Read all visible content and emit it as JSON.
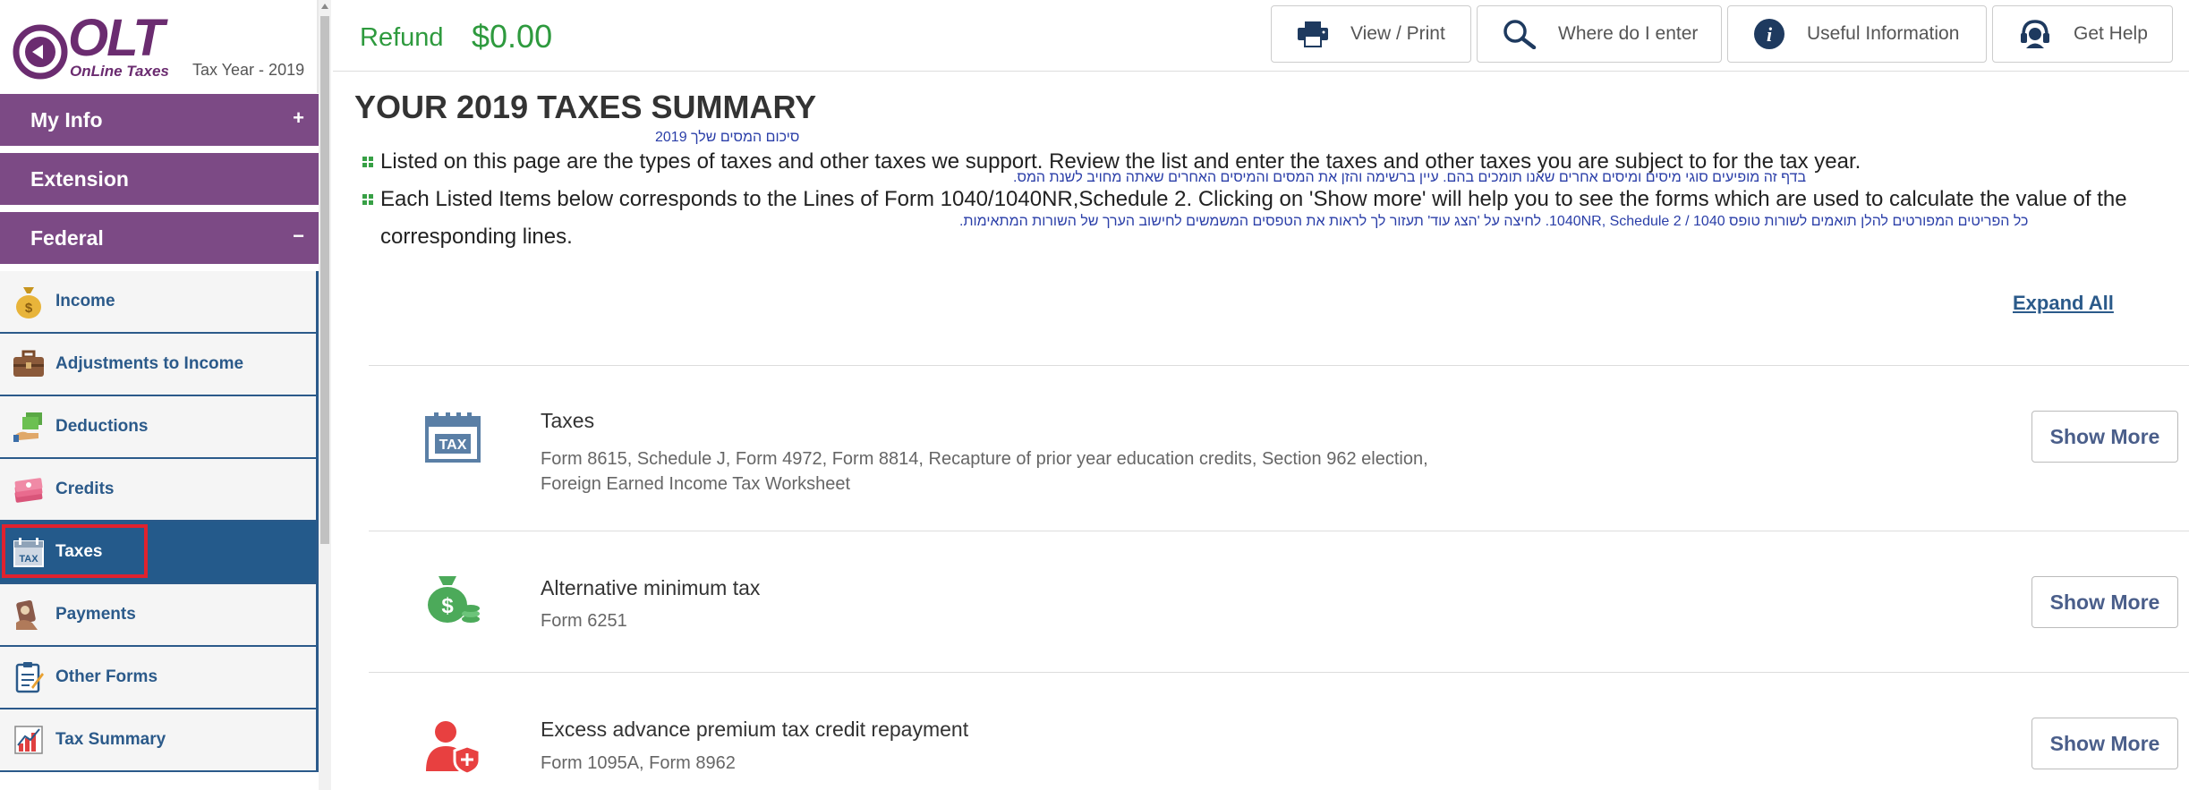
{
  "app": {
    "logo_text": "OLT",
    "logo_sub": "OnLine Taxes",
    "tax_year": "Tax Year - 2019"
  },
  "sidebar": {
    "sections": [
      {
        "label": "My Info",
        "sign": "+"
      },
      {
        "label": "Extension",
        "sign": ""
      },
      {
        "label": "Federal",
        "sign": "−"
      }
    ],
    "items": [
      {
        "label": "Income",
        "icon": "money-bag-icon"
      },
      {
        "label": "Adjustments to Income",
        "icon": "briefcase-icon"
      },
      {
        "label": "Deductions",
        "icon": "hand-money-icon"
      },
      {
        "label": "Credits",
        "icon": "money-stack-icon"
      },
      {
        "label": "Taxes",
        "icon": "tax-calendar-icon",
        "active": true
      },
      {
        "label": "Payments",
        "icon": "payment-hand-icon"
      },
      {
        "label": "Other Forms",
        "icon": "clipboard-icon"
      },
      {
        "label": "Tax Summary",
        "icon": "chart-icon"
      }
    ]
  },
  "header": {
    "refund_label": "Refund",
    "refund_value": "$0.00",
    "buttons": [
      {
        "label": "View / Print",
        "icon": "printer-icon"
      },
      {
        "label": "Where do I enter",
        "icon": "search-icon"
      },
      {
        "label": "Useful Information",
        "icon": "info-icon"
      },
      {
        "label": "Get Help",
        "icon": "support-agent-icon"
      }
    ]
  },
  "main": {
    "title": "YOUR 2019 TAXES SUMMARY",
    "title_hebrew": "סיכום המסים שלך 2019",
    "intro": [
      {
        "text": "Listed on this page are the types of taxes and other taxes we support. Review the list and enter the taxes and other taxes you are subject to for the tax year.",
        "hebrew": "בדף זה מופיעים סוגי מיסים ומיסים אחרים שאנו תומכים בהם. עיין ברשימה והזן את המסים והמיסים האחרים שאתה מחויב לשנת המס."
      },
      {
        "text_line1": "Each Listed Items below corresponds to the Lines of Form 1040/1040NR,Schedule 2. Clicking on 'Show more' will help you to see the forms which are used to calculate the value of the",
        "text_line2": "corresponding lines.",
        "hebrew": "כל הפריטים המפורטים להלן תואמים לשורות טופס 1040 / 1040NR, Schedule 2. לחיצה על 'הצג עוד' תעזור לך לראות את הטפסים המשמשים לחישוב הערך של השורות המתאימות."
      }
    ],
    "expand_all": "Expand All",
    "rows": [
      {
        "title": "Taxes",
        "desc_line1": "Form 8615, Schedule J, Form 4972, Form 8814, Recapture of prior year education credits, Section 962 election,",
        "desc_line2": "Foreign Earned Income Tax Worksheet",
        "button": "Show More",
        "icon": "tax-calendar-icon"
      },
      {
        "title": "Alternative minimum tax",
        "desc_line1": "Form 6251",
        "button": "Show More",
        "icon": "money-bag-coins-icon"
      },
      {
        "title": "Excess advance premium tax credit repayment",
        "desc_line1": "Form 1095A, Form 8962",
        "button": "Show More",
        "icon": "person-shield-icon"
      }
    ]
  },
  "colors": {
    "purple": "#7c4a85",
    "blue": "#245a8b",
    "green": "#2e9a3e",
    "highlight_red": "#e0222e"
  }
}
